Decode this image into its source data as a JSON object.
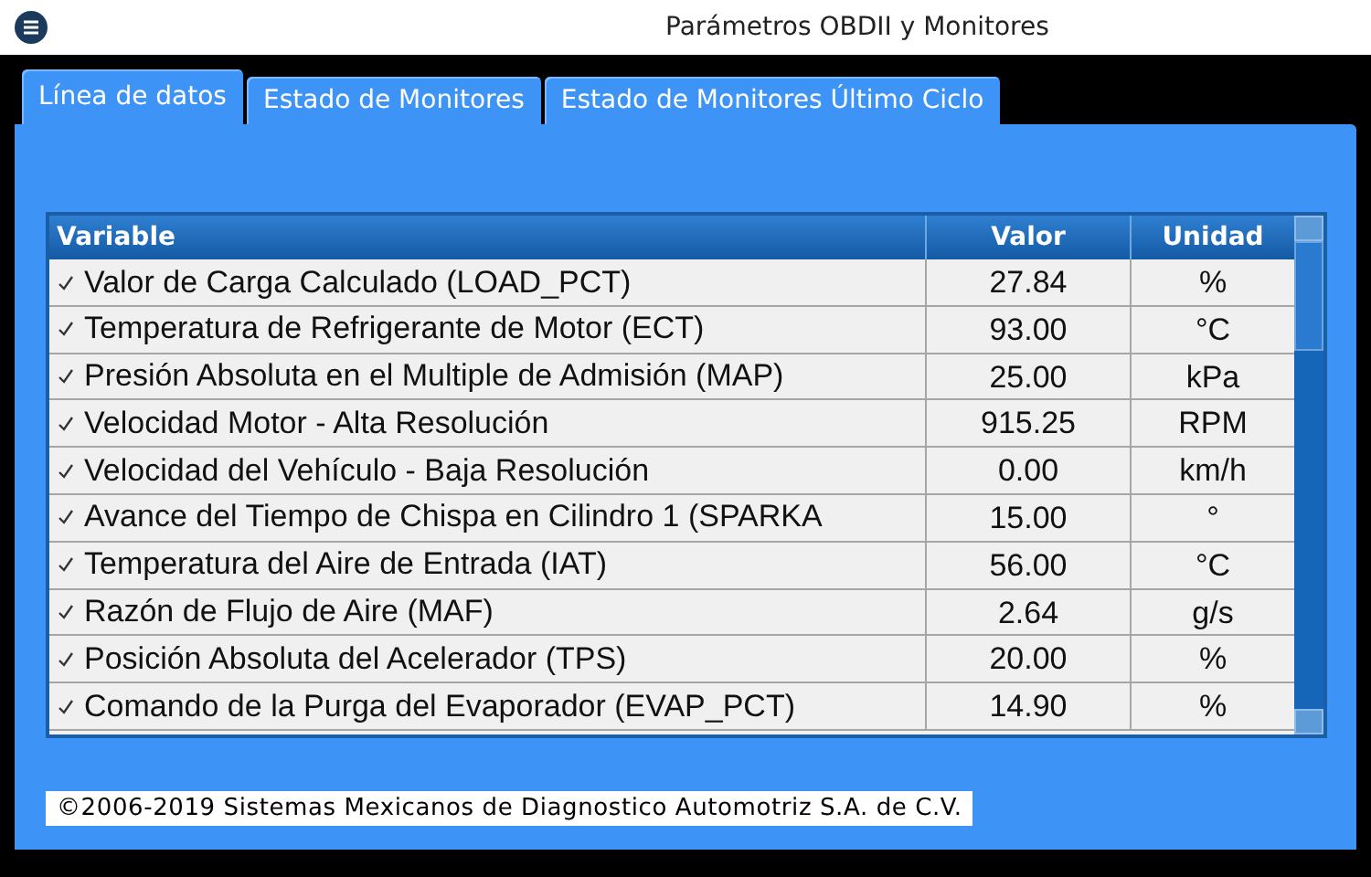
{
  "window": {
    "title": "Parámetros OBDII y Monitores"
  },
  "tabs": [
    {
      "label": "Línea de datos",
      "selected": true
    },
    {
      "label": "Estado de Monitores",
      "selected": false
    },
    {
      "label": "Estado de Monitores Último Ciclo",
      "selected": false
    }
  ],
  "table": {
    "columns": [
      "Variable",
      "Valor",
      "Unidad"
    ],
    "rows": [
      {
        "checked": true,
        "variable": "Valor de Carga Calculado (LOAD_PCT)",
        "valor": "27.84",
        "unidad": "%"
      },
      {
        "checked": true,
        "variable": "Temperatura de Refrigerante de Motor (ECT)",
        "valor": "93.00",
        "unidad": "°C"
      },
      {
        "checked": true,
        "variable": "Presión Absoluta en el Multiple de Admisión (MAP)",
        "valor": "25.00",
        "unidad": "kPa"
      },
      {
        "checked": true,
        "variable": "Velocidad Motor - Alta Resolución",
        "valor": "915.25",
        "unidad": "RPM"
      },
      {
        "checked": true,
        "variable": "Velocidad del Vehículo - Baja Resolución",
        "valor": "0.00",
        "unidad": "km/h"
      },
      {
        "checked": true,
        "variable": "Avance del Tiempo de Chispa en Cilindro 1 (SPARKA",
        "valor": "15.00",
        "unidad": "°"
      },
      {
        "checked": true,
        "variable": "Temperatura del Aire de Entrada (IAT)",
        "valor": "56.00",
        "unidad": "°C"
      },
      {
        "checked": true,
        "variable": "Razón de Flujo de Aire (MAF)",
        "valor": "2.64",
        "unidad": "g/s"
      },
      {
        "checked": true,
        "variable": "Posición Absoluta del Acelerador (TPS)",
        "valor": "20.00",
        "unidad": "%"
      },
      {
        "checked": true,
        "variable": "Comando de la Purga del Evaporador (EVAP_PCT)",
        "valor": "14.90",
        "unidad": "%"
      }
    ]
  },
  "footer": {
    "copyright": "©2006-2019 Sistemas Mexicanos de Diagnostico Automotriz S.A. de C.V."
  }
}
